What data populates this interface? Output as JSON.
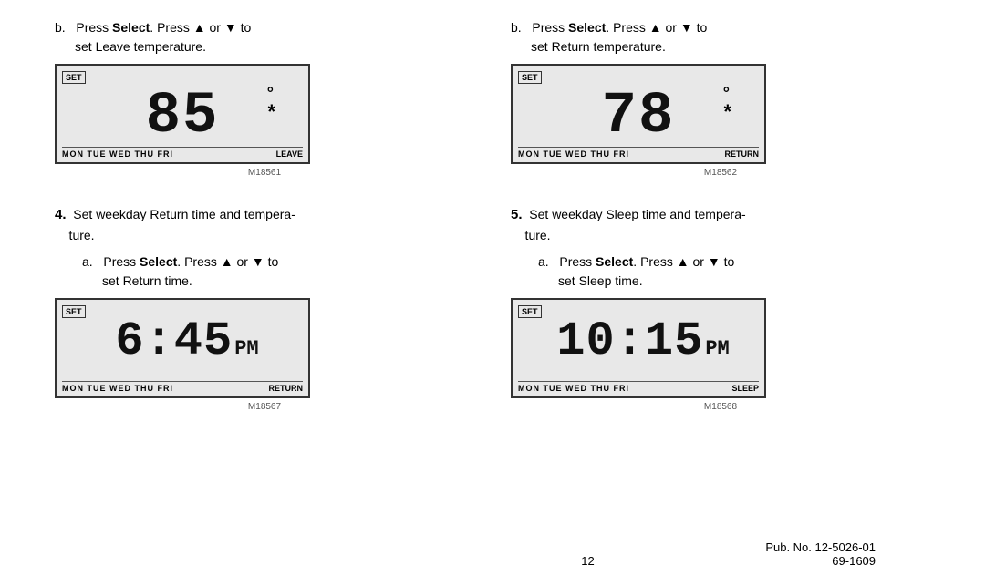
{
  "page": {
    "number": "12",
    "pub_no": "Pub. No. 12-5026-01",
    "model_no": "69-1609"
  },
  "top_left": {
    "sub_letter": "b.",
    "text_part1": "Press ",
    "select_bold": "Select",
    "text_part2": ". Press ",
    "arrow_up": "▲",
    "text_or": " or ",
    "arrow_down": "▼",
    "text_to": " to",
    "text_line2": "set Leave temperature.",
    "display": {
      "set_badge": "SET",
      "big_number": "85",
      "degree": "°",
      "asterisk": "*",
      "mode": "LEAVE",
      "days": "MON TUE WED THU FRI",
      "model_id": "M18561"
    }
  },
  "top_right": {
    "sub_letter": "b.",
    "text_part1": "Press ",
    "select_bold": "Select",
    "text_part2": ". Press ",
    "arrow_up": "▲",
    "text_or": " or ",
    "arrow_down": "▼",
    "text_to": " to",
    "text_line2": "set Return temperature.",
    "display": {
      "set_badge": "SET",
      "big_number": "78",
      "degree": "°",
      "asterisk": "*",
      "mode": "RETURN",
      "days": "MON TUE WED THU FRI",
      "model_id": "M18562"
    }
  },
  "bottom_left": {
    "step_number": "4.",
    "step_text": "Set weekday Return time and tempera-ture.",
    "sub_letter": "a.",
    "text_part1": "Press ",
    "select_bold": "Select",
    "text_part2": ". Press ",
    "arrow_up": "▲",
    "text_or": " or ",
    "arrow_down": "▼",
    "text_to": " to",
    "text_line2": "set Return time.",
    "display": {
      "set_badge": "SET",
      "big_number": "6:45",
      "pm": "PM",
      "mode": "RETURN",
      "days": "MON TUE WED THU FRI",
      "model_id": "M18567"
    }
  },
  "bottom_right": {
    "step_number": "5.",
    "step_text": "Set weekday Sleep time and tempera-ture.",
    "sub_letter": "a.",
    "text_part1": "Press ",
    "select_bold": "Select",
    "text_part2": ". Press ",
    "arrow_up": "▲",
    "text_or": " or ",
    "arrow_down": "▼",
    "text_to": " to",
    "text_line2": "set Sleep time.",
    "display": {
      "set_badge": "SET",
      "big_number": "10:15",
      "pm": "PM",
      "mode": "SLEEP",
      "days": "MON TUE WED THU FRI",
      "model_id": "M18568"
    }
  }
}
